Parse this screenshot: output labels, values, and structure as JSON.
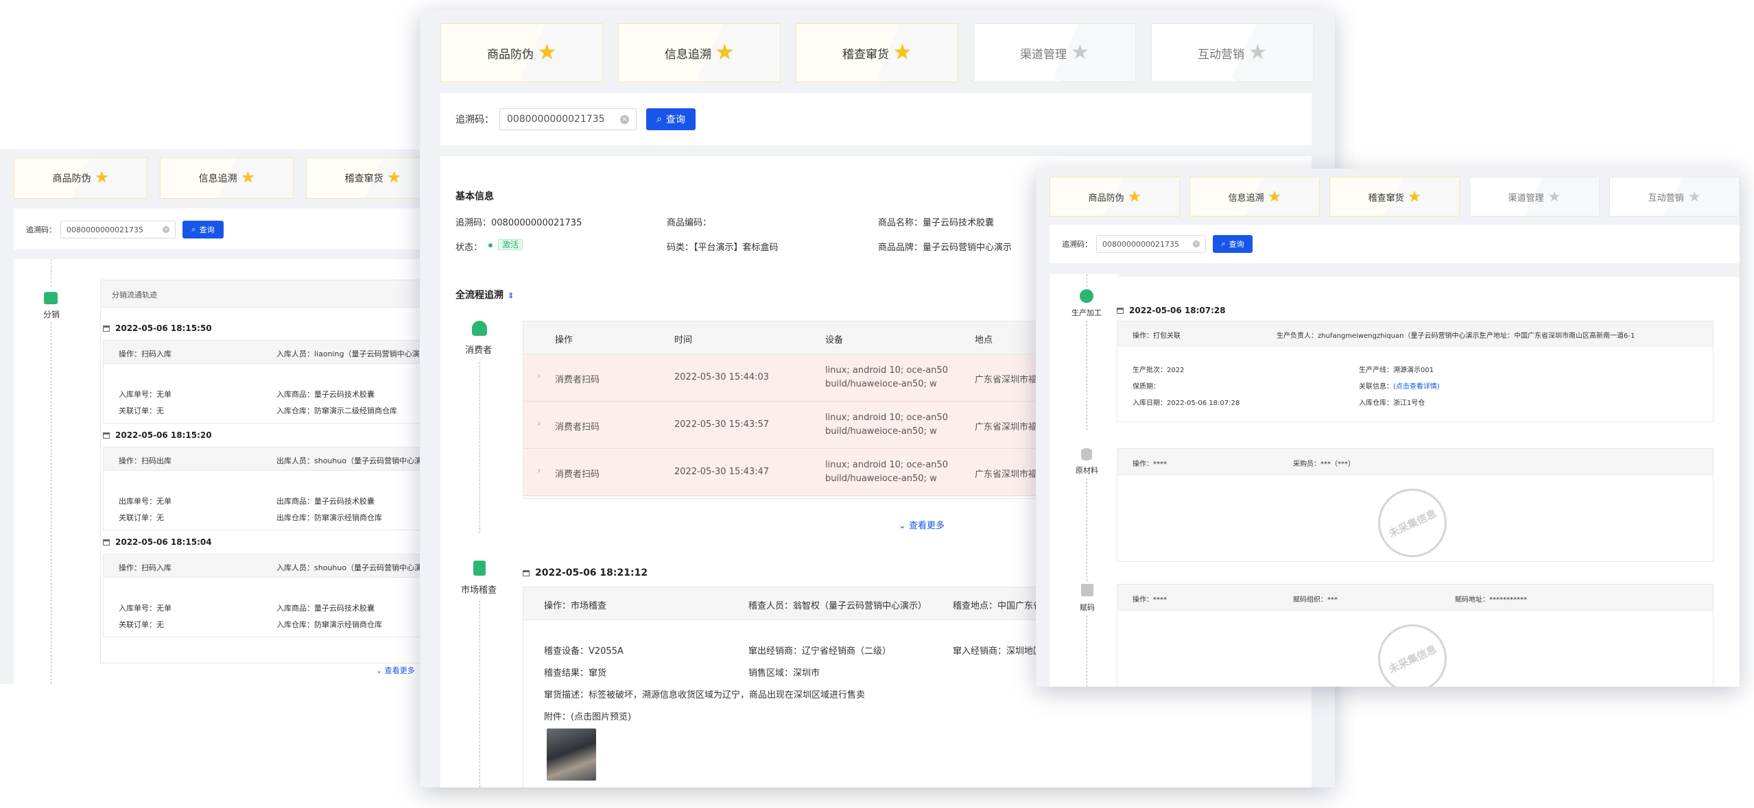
{
  "tabs": [
    {
      "label": "商品防伪",
      "active": true
    },
    {
      "label": "信息追溯",
      "active": true
    },
    {
      "label": "稽查窜货",
      "active": true
    },
    {
      "label": "渠道管理",
      "active": false
    },
    {
      "label": "互动营销",
      "active": false
    }
  ],
  "search": {
    "label": "追溯码：",
    "value": "0080000000021735",
    "button": "查询"
  },
  "left": {
    "node_label": "分销",
    "section_title": "分销流通轨迹",
    "more": "查看更多",
    "entries": [
      {
        "time": "2022-05-06 18:15:50",
        "op": "操作：扫码入库",
        "person": "入库人员：liaoning（量子云码营销中心演示）",
        "f1": "入库单号：无单",
        "f2": "入库商品：量子云码技术胶囊",
        "f3": "关联订单：无",
        "f4": "入库仓库：防窜演示二级经销商仓库"
      },
      {
        "time": "2022-05-06 18:15:20",
        "op": "操作：扫码出库",
        "person": "出库人员：shouhuo（量子云码营销中心演示）",
        "f1": "出库单号：无单",
        "f2": "出库商品：量子云码技术胶囊",
        "f3": "关联订单：无",
        "f4": "出库仓库：防窜演示经销商仓库"
      },
      {
        "time": "2022-05-06 18:15:04",
        "op": "操作：扫码入库",
        "person": "入库人员：shouhuo（量子云码营销中心演示）",
        "f1": "入库单号：无单",
        "f2": "入库商品：量子云码技术胶囊",
        "f3": "关联订单：无",
        "f4": "入库仓库：防窜演示经销商仓库"
      }
    ]
  },
  "center": {
    "basic_title": "基本信息",
    "code": "追溯码：0080000000021735",
    "product_code": "商品编码：",
    "product_name": "商品名称：量子云码技术胶囊",
    "status_label": "状态：",
    "status": "激活",
    "code_type": "码类：【平台演示】套标盒码",
    "brand": "商品品牌：量子云码营销中心演示",
    "flow_title": "全流程追溯",
    "consumer_label": "消费者",
    "columns": [
      "操作",
      "时间",
      "设备",
      "地点"
    ],
    "rows": [
      {
        "op": "消费者扫码",
        "time": "2022-05-30 15:44:03",
        "dev1": "linux; android 10; oce-an50",
        "dev2": "build/huaweioce-an50; w",
        "loc": "广东省深圳市福"
      },
      {
        "op": "消费者扫码",
        "time": "2022-05-30 15:43:57",
        "dev1": "linux; android 10; oce-an50",
        "dev2": "build/huaweioce-an50; w",
        "loc": "广东省深圳市福"
      },
      {
        "op": "消费者扫码",
        "time": "2022-05-30 15:43:47",
        "dev1": "linux; android 10; oce-an50",
        "dev2": "build/huaweioce-an50; w",
        "loc": "广东省深圳市福"
      }
    ],
    "more": "查看更多",
    "inspect_label": "市场稽查",
    "inspect_time": "2022-05-06 18:21:12",
    "inspect_op": "操作：市场稽查",
    "inspect_person": "稽查人员：翁智权（量子云码营销中心演示）",
    "inspect_place": "稽查地点：中国广东省",
    "device": "稽查设备：V2055A",
    "out_dealer": "窜出经销商：辽宁省经销商（二级）",
    "in_dealer": "窜入经销商：深圳地区",
    "result": "稽查结果：窜货",
    "region": "销售区域：深圳市",
    "desc": "窜货描述：标签被破坏，溯源信息收货区域为辽宁，商品出现在深圳区域进行售卖",
    "attach": "附件：(点击图片预览)"
  },
  "right": {
    "prod_label": "生产加工",
    "prod_time": "2022-05-06 18:07:28",
    "prod_op": "操作：打包关联",
    "prod_person": "生产负责人：zhufangmeiwengzhiquan（量子云码营销中心演示）",
    "prod_addr": "生产地址：中国广东省深圳市南山区高新南一道6-1",
    "batch": "生产批次：2022",
    "line": "生产产线：溯源演示001",
    "shelf": "保质期：",
    "assoc_label": "关联信息：",
    "assoc_link": "(点击查看详情)",
    "in_date": "入库日期：2022-05-06 18:07:28",
    "warehouse": "入库仓库：浙江1号仓",
    "raw_label": "原材料",
    "raw_op": "操作：****",
    "raw_buyer": "采购员：***（***）",
    "code_label": "赋码",
    "code_op": "操作：****",
    "code_org": "赋码组织：***",
    "code_addr": "赋码地址：***********",
    "stamp": "未采集信息"
  }
}
